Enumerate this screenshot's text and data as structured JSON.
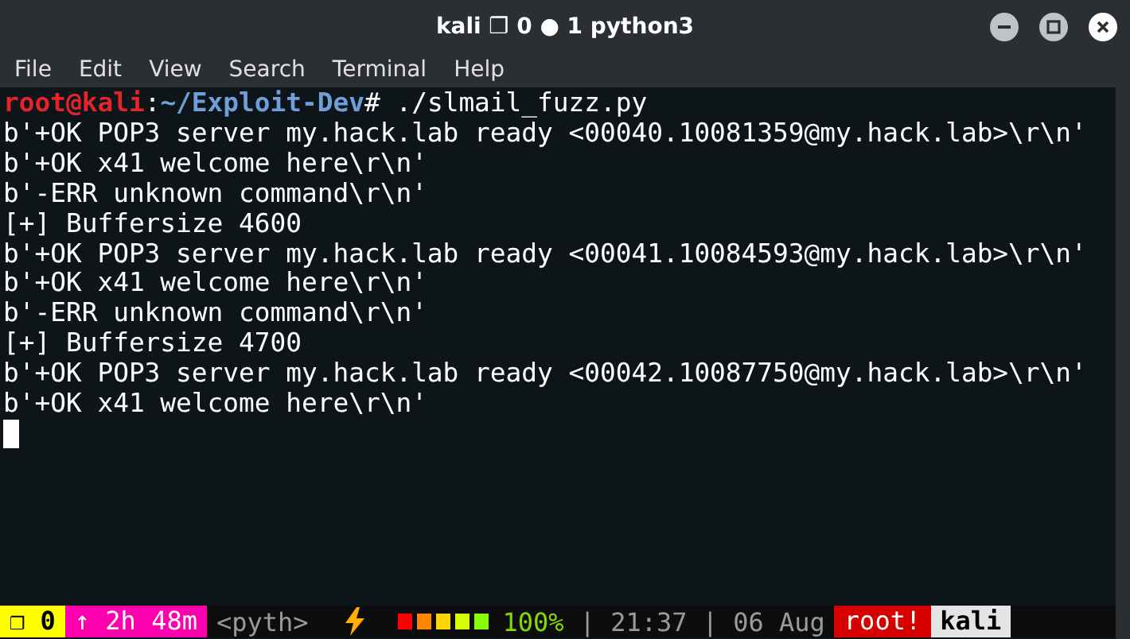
{
  "window": {
    "title": "kali ❐ 0 ● 1 python3"
  },
  "menu": [
    "File",
    "Edit",
    "View",
    "Search",
    "Terminal",
    "Help"
  ],
  "terminal": {
    "lines": [
      {
        "kind": "prompt",
        "user": "root@kali",
        "separator": ":",
        "path": "~/Exploit-Dev",
        "command": "# ./slmail_fuzz.py"
      },
      {
        "kind": "output",
        "text": "b'+OK POP3 server my.hack.lab ready <00040.10081359@my.hack.lab>\\r\\n'"
      },
      {
        "kind": "output",
        "text": "b'+OK x41 welcome here\\r\\n'"
      },
      {
        "kind": "output",
        "text": "b'-ERR unknown command\\r\\n'"
      },
      {
        "kind": "output",
        "text": "[+] Buffersize 4600"
      },
      {
        "kind": "output",
        "text": "b'+OK POP3 server my.hack.lab ready <00041.10084593@my.hack.lab>\\r\\n'"
      },
      {
        "kind": "output",
        "text": "b'+OK x41 welcome here\\r\\n'"
      },
      {
        "kind": "output",
        "text": "b'-ERR unknown command\\r\\n'"
      },
      {
        "kind": "output",
        "text": "[+] Buffersize 4700"
      },
      {
        "kind": "output",
        "text": "b'+OK POP3 server my.hack.lab ready <00042.10087750@my.hack.lab>\\r\\n'"
      },
      {
        "kind": "output",
        "text": "b'+OK x41 welcome here\\r\\n'"
      }
    ]
  },
  "status_bar": [
    {
      "kind": "segment",
      "text": "❐ 0",
      "color": "#ffff00"
    },
    {
      "kind": "segment",
      "text": "↑ 2h 48m",
      "color": "#ff00af"
    },
    {
      "kind": "plain",
      "text": "<pyth>"
    },
    {
      "kind": "power"
    },
    {
      "kind": "battery"
    },
    {
      "kind": "percent",
      "text": "100%"
    },
    {
      "kind": "plain",
      "text": "| 21:37 | 06 Aug"
    },
    {
      "kind": "segment",
      "text": "root!",
      "color": "#d70000"
    },
    {
      "kind": "segment",
      "text": "kali",
      "color": "#e4e4e4"
    }
  ]
}
